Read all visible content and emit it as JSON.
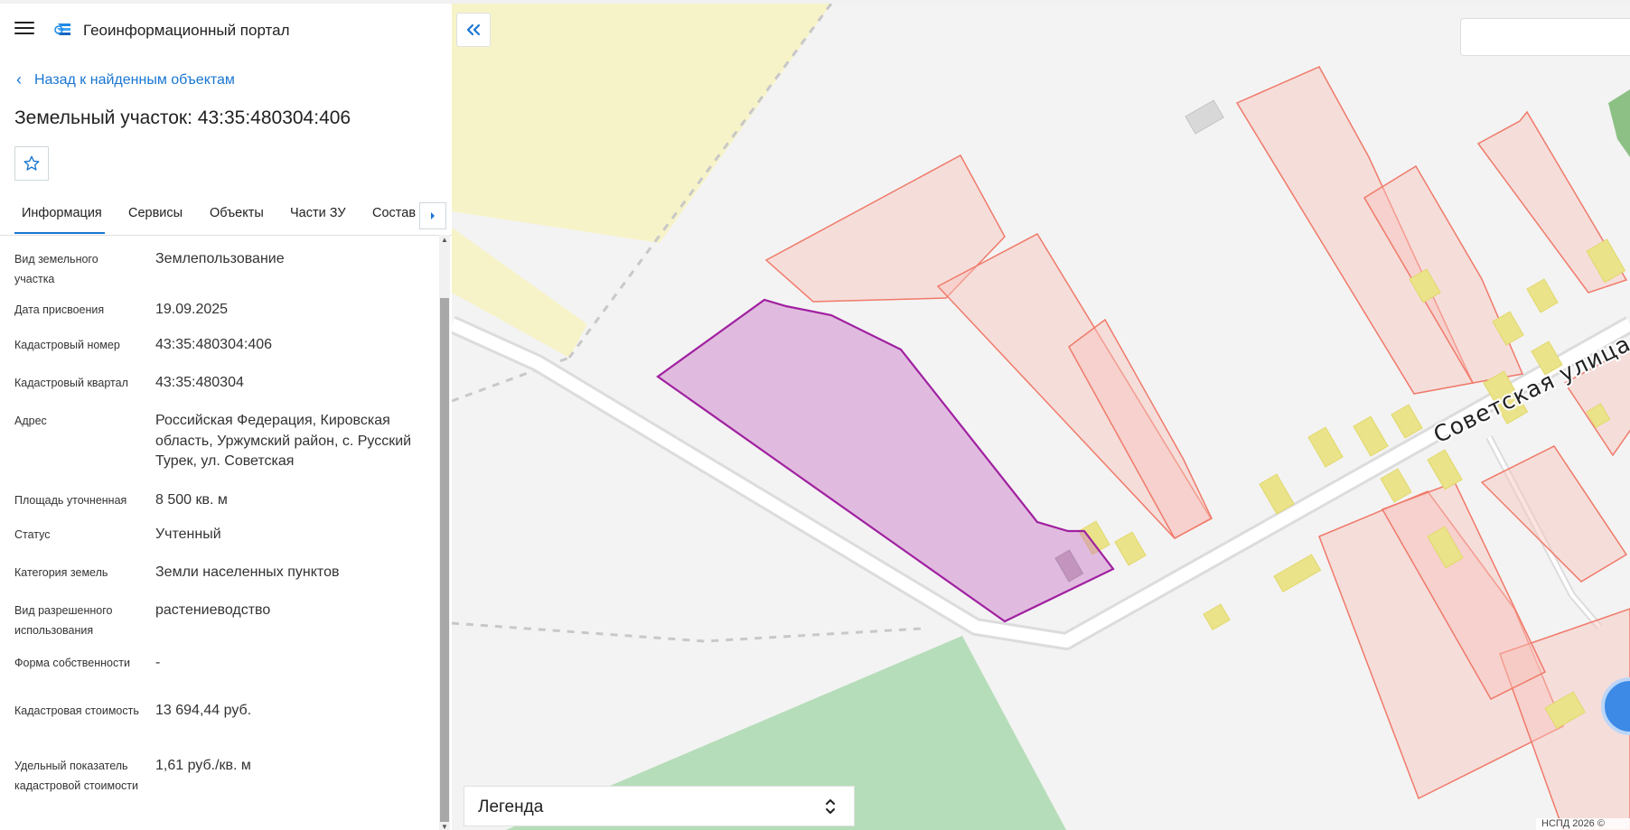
{
  "app": {
    "title": "Геоинформационный портал"
  },
  "nav": {
    "back_label": "Назад к найденным объектам"
  },
  "page": {
    "title": "Земельный участок: 43:35:480304:406"
  },
  "tabs": [
    {
      "label": "Информация",
      "active": true
    },
    {
      "label": "Сервисы"
    },
    {
      "label": "Объекты"
    },
    {
      "label": "Части ЗУ"
    },
    {
      "label": "Состав"
    }
  ],
  "info": [
    {
      "label": "Вид земельного участка",
      "value": "Землепользование"
    },
    {
      "label": "Дата присвоения",
      "value": "19.09.2025"
    },
    {
      "label": "Кадастровый номер",
      "value": "43:35:480304:406"
    },
    {
      "label": "Кадастровый квартал",
      "value": "43:35:480304"
    },
    {
      "label": "Адрес",
      "value": "Российская Федерация, Кировская область, Уржумский район, с. Русский Турек, ул. Советская"
    },
    {
      "label": "Площадь уточненная",
      "value": "8 500 кв. м"
    },
    {
      "label": "Статус",
      "value": "Учтенный"
    },
    {
      "label": "Категория земель",
      "value": "Земли населенных пунктов"
    },
    {
      "label": "Вид разрешенного использования",
      "value": "растениеводство"
    },
    {
      "label": "Форма собственности",
      "value": "-"
    },
    {
      "label": "Кадастровая стоимость",
      "value": "13 694,44 руб."
    },
    {
      "label": "Удельный показатель кадастровой стоимости",
      "value": "1,61 руб./кв. м"
    }
  ],
  "map": {
    "street_label": "Советская улица",
    "legend_label": "Легенда",
    "copyright": "НСПД 2026 ©",
    "colors": {
      "selected_parcel": "#a020a0",
      "parcel_outline": "#f07a6a",
      "building": "#e8e07a",
      "accent": "#1976d2"
    }
  },
  "icons": [
    "menu-icon",
    "logo-icon",
    "chevron-left-icon",
    "star-icon",
    "arrow-right-icon",
    "double-chevron-left-icon",
    "unfold-icon"
  ]
}
